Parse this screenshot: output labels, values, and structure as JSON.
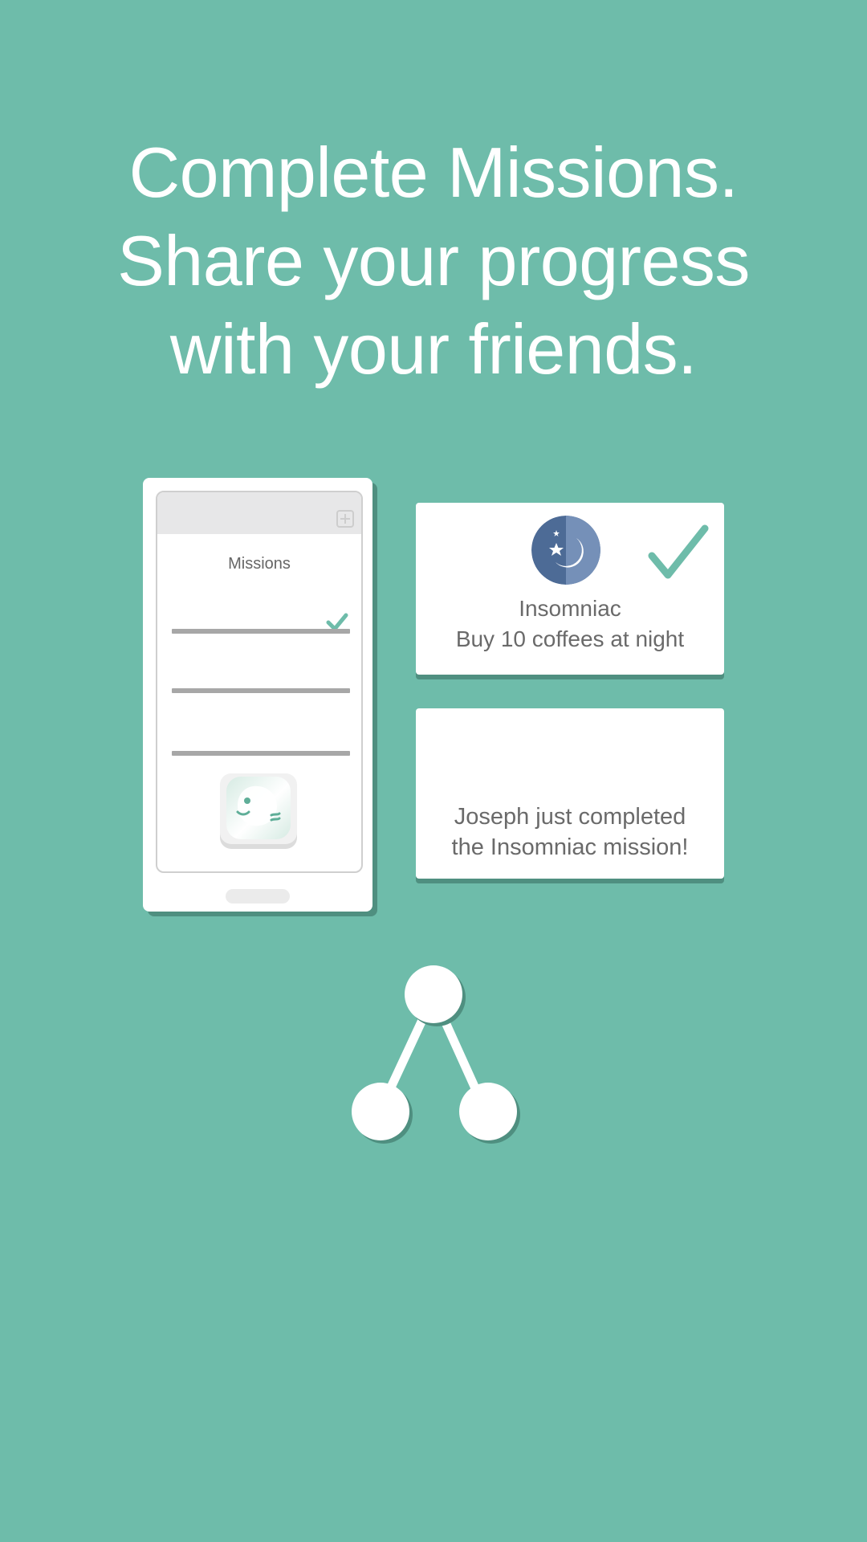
{
  "headline": {
    "line1": "Complete Missions.",
    "line2": "Share your progress",
    "line3": "with your friends."
  },
  "phone": {
    "screen_title": "Missions",
    "mission_count": 3,
    "completed_missions": 1
  },
  "mission_card": {
    "badge_icon": "moon-stars-icon",
    "title": "Insomniac",
    "subtitle": "Buy 10 coffees at night",
    "status_icon": "check-icon"
  },
  "notification_card": {
    "line1": "Joseph just completed",
    "line2": "the Insomniac mission!"
  },
  "share_icon": "share-icon",
  "colors": {
    "background": "#6ebcaa",
    "accent": "#6ebcaa",
    "badge_dark": "#4d6b96",
    "badge_light": "#7590b8",
    "shadow": "#4f8f80"
  }
}
